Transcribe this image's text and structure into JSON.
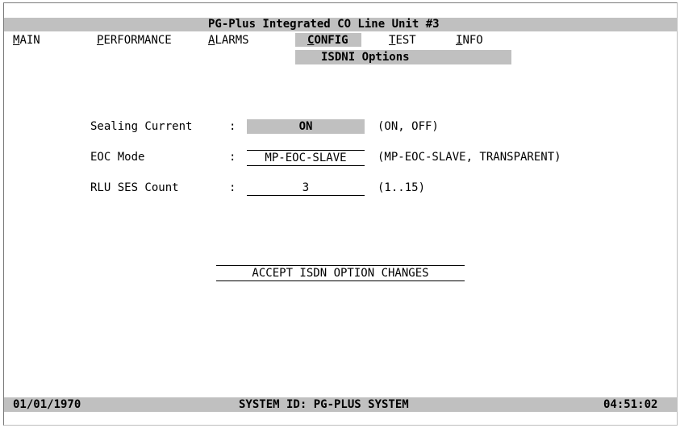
{
  "header": {
    "title": "PG-Plus Integrated CO Line Unit #3"
  },
  "menu": {
    "items": [
      {
        "hotkey": "M",
        "rest": "AIN"
      },
      {
        "hotkey": "P",
        "rest": "ERFORMANCE"
      },
      {
        "hotkey": "A",
        "rest": "LARMS"
      },
      {
        "hotkey": "C",
        "rest": "ONFIG"
      },
      {
        "hotkey": "T",
        "rest": "EST"
      },
      {
        "hotkey": "I",
        "rest": "NFO"
      }
    ],
    "submenu_title": "ISDNI Options"
  },
  "form": {
    "sealing": {
      "label": "Sealing Current",
      "colon": ":",
      "value": "ON",
      "hint": "(ON, OFF)"
    },
    "eoc": {
      "label": "EOC Mode",
      "colon": ":",
      "value": "MP-EOC-SLAVE",
      "hint": "(MP-EOC-SLAVE, TRANSPARENT)"
    },
    "rlu": {
      "label": "RLU SES Count",
      "colon": ":",
      "value": "3",
      "hint": "(1..15)"
    },
    "accept_label": "ACCEPT ISDN OPTION CHANGES"
  },
  "status": {
    "date": "01/01/1970",
    "system_id": "SYSTEM ID: PG-PLUS SYSTEM",
    "time": "04:51:02"
  },
  "colors": {
    "highlight_bar": "#c0c0c0",
    "background": "#ffffff",
    "text": "#000000"
  }
}
